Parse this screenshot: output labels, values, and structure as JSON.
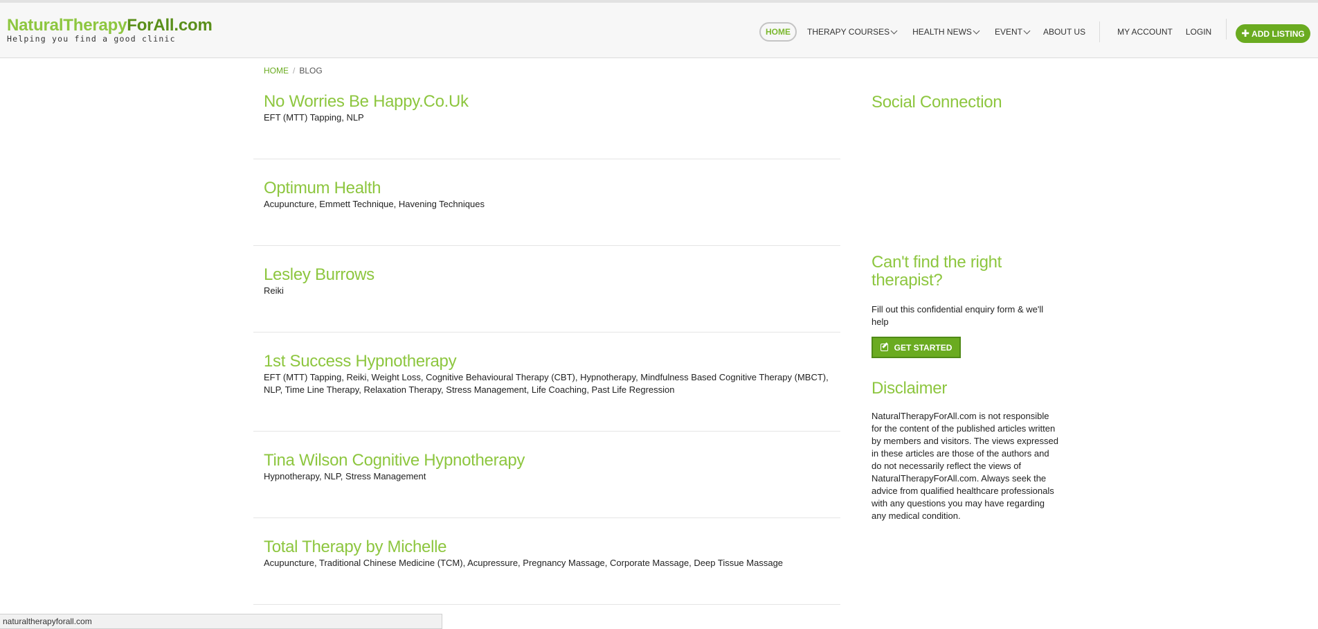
{
  "header": {
    "logo_part1": "NaturalTherapy",
    "logo_part2": "ForAll.com",
    "tagline": "Helping you find a good clinic"
  },
  "nav": {
    "home": "HOME",
    "therapy_courses": "THERAPY COURSES",
    "health_news": "HEALTH NEWS",
    "event": "EVENT",
    "about_us": "ABOUT US",
    "my_account": "MY ACCOUNT",
    "login": "LOGIN",
    "add_listing": "ADD LISTING"
  },
  "breadcrumb": {
    "home": "HOME",
    "current": "BLOG"
  },
  "listings": [
    {
      "title": "No Worries Be Happy.Co.Uk",
      "tags": "EFT (MTT) Tapping, NLP"
    },
    {
      "title": "Optimum Health",
      "tags": "Acupuncture, Emmett Technique, Havening Techniques"
    },
    {
      "title": "Lesley Burrows",
      "tags": "Reiki"
    },
    {
      "title": "1st Success Hypnotherapy",
      "tags": "EFT (MTT) Tapping, Reiki, Weight Loss, Cognitive Behavioural Therapy (CBT), Hypnotherapy, Mindfulness Based Cognitive Therapy (MBCT), NLP, Time Line Therapy, Relaxation Therapy, Stress Management, Life Coaching, Past Life Regression"
    },
    {
      "title": "Tina Wilson Cognitive Hypnotherapy",
      "tags": "Hypnotherapy, NLP, Stress Management"
    },
    {
      "title": "Total Therapy by Michelle",
      "tags": "Acupuncture, Traditional Chinese Medicine (TCM), Acupressure, Pregnancy Massage, Corporate Massage, Deep Tissue Massage"
    }
  ],
  "sidebar": {
    "social_title": "Social Connection",
    "find_title": "Can't find the right therapist?",
    "find_text": "Fill out this confidential enquiry form & we'll help",
    "get_started": "GET STARTED",
    "disclaimer_title": "Disclaimer",
    "disclaimer_text": "NaturalTherapyForAll.com is not responsible for the content of the published articles written by members and visitors. The views expressed in these articles are those of the authors and do not necessarily reflect the views of NaturalTherapyForAll.com. Always seek the advice from qualified healthcare professionals with any questions you may have regarding any medical condition."
  },
  "status_bar": {
    "url": "naturaltherapyforall.com"
  },
  "colors": {
    "brand_green": "#8dc63f",
    "button_green": "#6aab20"
  }
}
